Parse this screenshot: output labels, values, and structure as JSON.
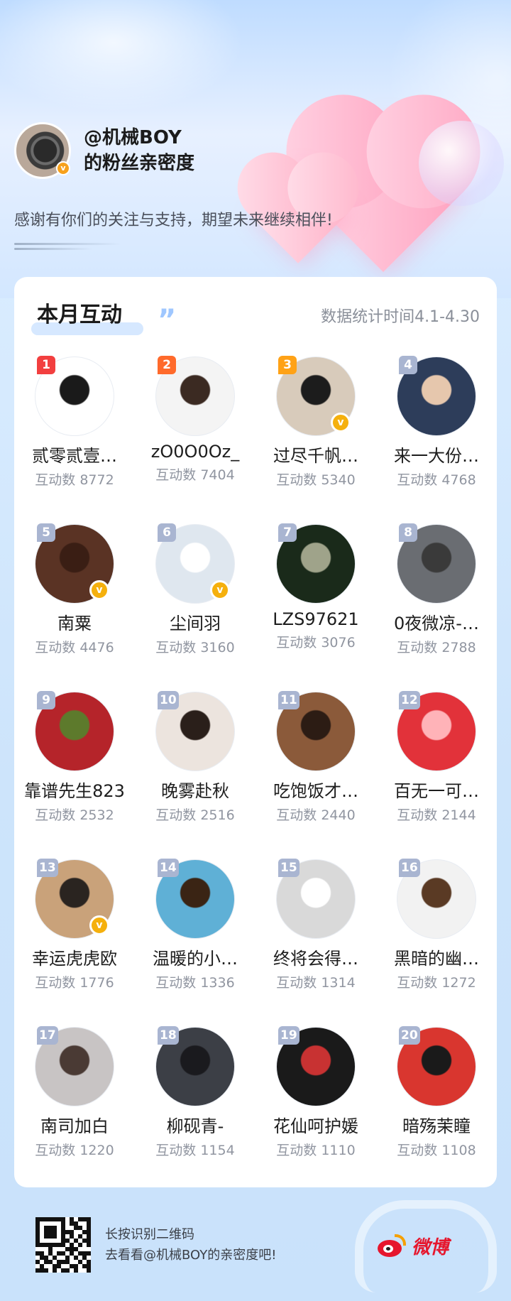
{
  "header": {
    "name": "@机械BOY",
    "subtitle": "的粉丝亲密度",
    "thanks": "感谢有你们的关注与支持，期望未来继续相伴!"
  },
  "card": {
    "title": "本月互动",
    "stat_time": "数据统计时间4.1-4.30"
  },
  "fans": [
    {
      "rank": "1",
      "name": "贰零贰壹…",
      "count": "互动数 8772",
      "verified": false,
      "avatar_bg": "#ffffff",
      "avatar_accent": "#1a1a1a"
    },
    {
      "rank": "2",
      "name": "zO0O0Oz_",
      "count": "互动数 7404",
      "verified": false,
      "avatar_bg": "#f4f4f4",
      "avatar_accent": "#3b2a22"
    },
    {
      "rank": "3",
      "name": "过尽千帆…",
      "count": "互动数 5340",
      "verified": true,
      "avatar_bg": "#d8cbbb",
      "avatar_accent": "#1c1c1c"
    },
    {
      "rank": "4",
      "name": "来一大份…",
      "count": "互动数 4768",
      "verified": false,
      "avatar_bg": "#2d3d5a",
      "avatar_accent": "#e6c7ad"
    },
    {
      "rank": "5",
      "name": "南粟",
      "count": "互动数 4476",
      "verified": true,
      "avatar_bg": "#5a3324",
      "avatar_accent": "#3a1e14"
    },
    {
      "rank": "6",
      "name": "尘间羽",
      "count": "互动数 3160",
      "verified": true,
      "avatar_bg": "#dfe7ef",
      "avatar_accent": "#ffffff"
    },
    {
      "rank": "7",
      "name": "LZS97621",
      "count": "互动数 3076",
      "verified": false,
      "avatar_bg": "#1a2a1a",
      "avatar_accent": "#9fa38a"
    },
    {
      "rank": "8",
      "name": "0夜微凉-…",
      "count": "互动数 2788",
      "verified": false,
      "avatar_bg": "#6a6d72",
      "avatar_accent": "#3a3a3a"
    },
    {
      "rank": "9",
      "name": "靠谱先生823",
      "count": "互动数 2532",
      "verified": false,
      "avatar_bg": "#b5242a",
      "avatar_accent": "#5d7a2c"
    },
    {
      "rank": "10",
      "name": "晚雾赴秋",
      "count": "互动数 2516",
      "verified": false,
      "avatar_bg": "#ece4de",
      "avatar_accent": "#2a1f1a"
    },
    {
      "rank": "11",
      "name": "吃饱饭才…",
      "count": "互动数 2440",
      "verified": false,
      "avatar_bg": "#8b5a3a",
      "avatar_accent": "#2c1c14"
    },
    {
      "rank": "12",
      "name": "百无一可…",
      "count": "互动数 2144",
      "verified": false,
      "avatar_bg": "#e2323a",
      "avatar_accent": "#ffb3b8"
    },
    {
      "rank": "13",
      "name": "幸运虎虎欧",
      "count": "互动数 1776",
      "verified": true,
      "avatar_bg": "#c9a27a",
      "avatar_accent": "#2a2420"
    },
    {
      "rank": "14",
      "name": "温暖的小…",
      "count": "互动数 1336",
      "verified": false,
      "avatar_bg": "#5fb0d6",
      "avatar_accent": "#3a2414"
    },
    {
      "rank": "15",
      "name": "终将会得…",
      "count": "互动数 1314",
      "verified": false,
      "avatar_bg": "#d9d9d9",
      "avatar_accent": "#ffffff"
    },
    {
      "rank": "16",
      "name": "黑暗的幽…",
      "count": "互动数 1272",
      "verified": false,
      "avatar_bg": "#f2f2f2",
      "avatar_accent": "#5a3a24"
    },
    {
      "rank": "17",
      "name": "南司加白",
      "count": "互动数 1220",
      "verified": false,
      "avatar_bg": "#c8c4c4",
      "avatar_accent": "#4a3a34"
    },
    {
      "rank": "18",
      "name": "柳砚青-",
      "count": "互动数 1154",
      "verified": false,
      "avatar_bg": "#3c3f46",
      "avatar_accent": "#1a1a1e"
    },
    {
      "rank": "19",
      "name": "花仙呵护媛",
      "count": "互动数 1110",
      "verified": false,
      "avatar_bg": "#1a1a1a",
      "avatar_accent": "#c83232"
    },
    {
      "rank": "20",
      "name": "暗殇茉瞳",
      "count": "互动数 1108",
      "verified": false,
      "avatar_bg": "#d9362f",
      "avatar_accent": "#1a1a1a"
    }
  ],
  "footer": {
    "line1": "长按识别二维码",
    "line2": "去看看@机械BOY的亲密度吧!",
    "brand": "微博"
  },
  "colors": {
    "rank1": "#f23f3f",
    "rank2": "#ff6a2b",
    "rank3": "#ffa216",
    "rank_default": "#a9b5d1",
    "verified": "#f5b00d",
    "weibo_red": "#e6162d"
  },
  "icons": {
    "verified": "v-badge-icon",
    "quote": "quote-icon",
    "weibo": "weibo-logo-icon"
  }
}
